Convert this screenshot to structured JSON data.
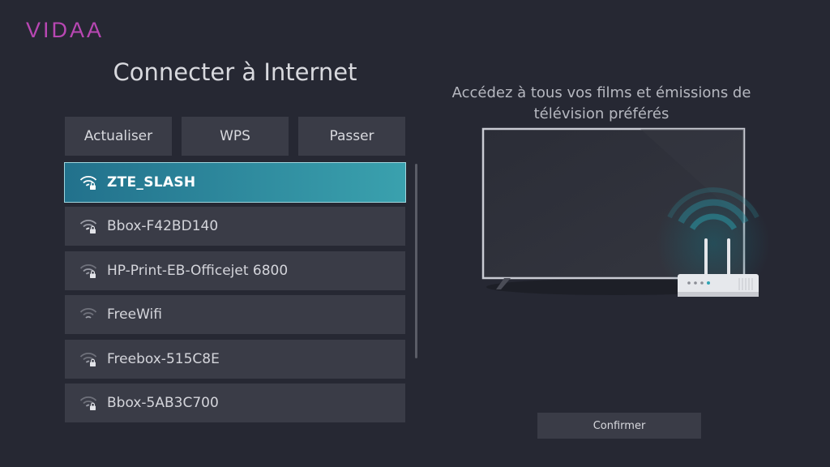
{
  "brand": {
    "logo": "VIDAA"
  },
  "page": {
    "title": "Connecter à Internet"
  },
  "actions": {
    "refresh": "Actualiser",
    "wps": "WPS",
    "skip": "Passer"
  },
  "networks": [
    {
      "name": "ZTE_SLASH",
      "secured": true,
      "selected": true
    },
    {
      "name": "Bbox-F42BD140",
      "secured": true,
      "selected": false
    },
    {
      "name": "HP-Print-EB-Officejet 6800",
      "secured": true,
      "selected": false
    },
    {
      "name": "FreeWifi",
      "secured": false,
      "selected": false
    },
    {
      "name": "Freebox-515C8E",
      "secured": true,
      "selected": false
    },
    {
      "name": "Bbox-5AB3C700",
      "secured": true,
      "selected": false
    }
  ],
  "info": {
    "line1": "Accédez à tous vos films et émissions de",
    "line2": "télévision préférés"
  },
  "footer": {
    "confirm": "Confirmer"
  },
  "colors": {
    "brand": "#b847b3",
    "selected_start": "#22718c",
    "selected_end": "#3aa1ae",
    "background": "#262833"
  },
  "icons": {
    "wifi": "wifi-icon",
    "lock": "lock-icon"
  }
}
